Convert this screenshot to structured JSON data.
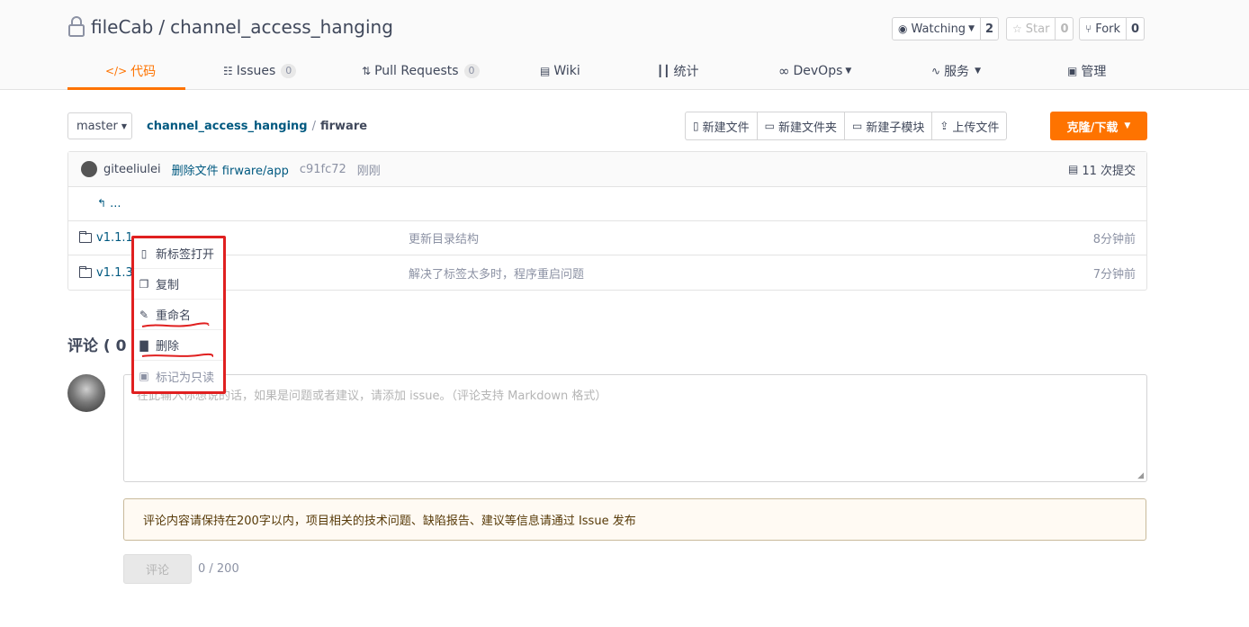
{
  "repo": {
    "owner": "fileCab",
    "separator": "/",
    "name": "channel_access_hanging"
  },
  "actions": {
    "watch": {
      "label": "Watching",
      "count": "2"
    },
    "star": {
      "label": "Star",
      "count": "0"
    },
    "fork": {
      "label": "Fork",
      "count": "0"
    }
  },
  "tabs": [
    {
      "label": "代码",
      "icon": "code-icon",
      "active": true
    },
    {
      "label": "Issues",
      "badge": "0",
      "icon": "issues-icon"
    },
    {
      "label": "Pull Requests",
      "badge": "0",
      "icon": "pull-request-icon"
    },
    {
      "label": "Wiki",
      "icon": "book-icon"
    },
    {
      "label": "统计",
      "icon": "bar-chart-icon"
    },
    {
      "label": "DevOps",
      "icon": "infinity-icon"
    },
    {
      "label": "服务",
      "icon": "pulse-icon"
    },
    {
      "label": "管理",
      "icon": "settings-doc-icon"
    }
  ],
  "branch": {
    "label": "master"
  },
  "breadcrumb": {
    "repo": "channel_access_hanging",
    "sep": "/",
    "path": "firware"
  },
  "toolbar": {
    "new_file": "新建文件",
    "new_folder": "新建文件夹",
    "new_submodule": "新建子模块",
    "upload": "上传文件",
    "clone": "克隆/下载"
  },
  "last_commit": {
    "author": "giteeliulei",
    "message": "删除文件 firware/app",
    "sha": "c91fc72",
    "time": "刚刚",
    "commits": "11 次提交"
  },
  "back_link": "...",
  "files": [
    {
      "name": "v1.1.1",
      "message": "更新目录结构",
      "time": "8分钟前"
    },
    {
      "name": "v1.1.3",
      "message": "解决了标签太多时，程序重启问题",
      "time": "7分钟前"
    }
  ],
  "context_menu": [
    {
      "label": "新标签打开",
      "icon": "file-icon"
    },
    {
      "label": "复制",
      "icon": "copy-icon"
    },
    {
      "label": "重命名",
      "icon": "edit-icon"
    },
    {
      "label": "删除",
      "icon": "trash-icon"
    },
    {
      "label": "标记为只读",
      "icon": "lock-icon",
      "muted": true
    }
  ],
  "comments": {
    "title": "评论 ( 0 )",
    "placeholder": "在此输入你想说的话，如果是问题或者建议，请添加 issue。（评论支持 Markdown 格式）",
    "notice": "评论内容请保持在200字以内，项目相关的技术问题、缺陷报告、建议等信息请通过 Issue 发布",
    "submit": "评论",
    "counter": "0 / 200"
  },
  "colors": {
    "accent": "#fe7300",
    "link": "#005980",
    "highlight": "#e02020"
  }
}
